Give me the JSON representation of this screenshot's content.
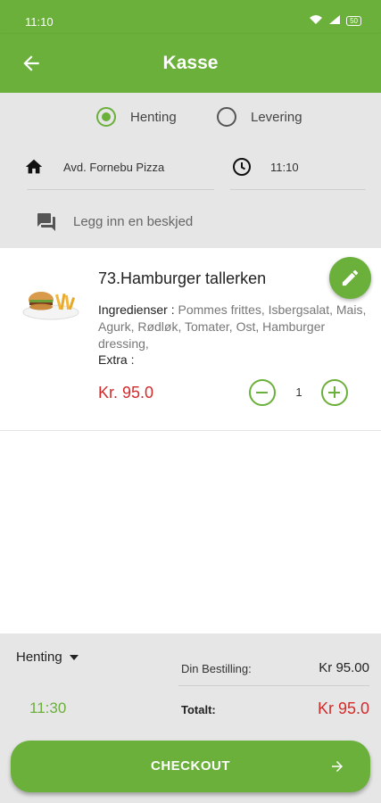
{
  "status_bar": {
    "time": "11:10",
    "battery": "50"
  },
  "header": {
    "title": "Kasse"
  },
  "delivery_options": {
    "pickup_label": "Henting",
    "delivery_label": "Levering",
    "selected": "Henting"
  },
  "location": {
    "store": "Avd. Fornebu Pizza",
    "time": "11:10"
  },
  "message": {
    "placeholder": "Legg inn en beskjed"
  },
  "cart_item": {
    "name": "73.Hamburger tallerken",
    "ingredients_label": "Ingredienser :",
    "ingredients": " Pommes frittes, Isbergsalat, Mais, Agurk, Rødløk, Tomater, Ost, Hamburger dressing,",
    "extra_label": "Extra :",
    "price": "Kr. 95.0",
    "quantity": "1"
  },
  "footer": {
    "mode": "Henting",
    "pickup_time": "11:30",
    "order_label": "Din Bestilling:",
    "order_value": "Kr 95.00",
    "total_label": "Totalt:",
    "total_value": "Kr 95.0"
  },
  "checkout": {
    "label": "CHECKOUT"
  },
  "colors": {
    "accent": "#6ab03a",
    "price": "#d42a2a",
    "panel": "#e6e6e6"
  }
}
